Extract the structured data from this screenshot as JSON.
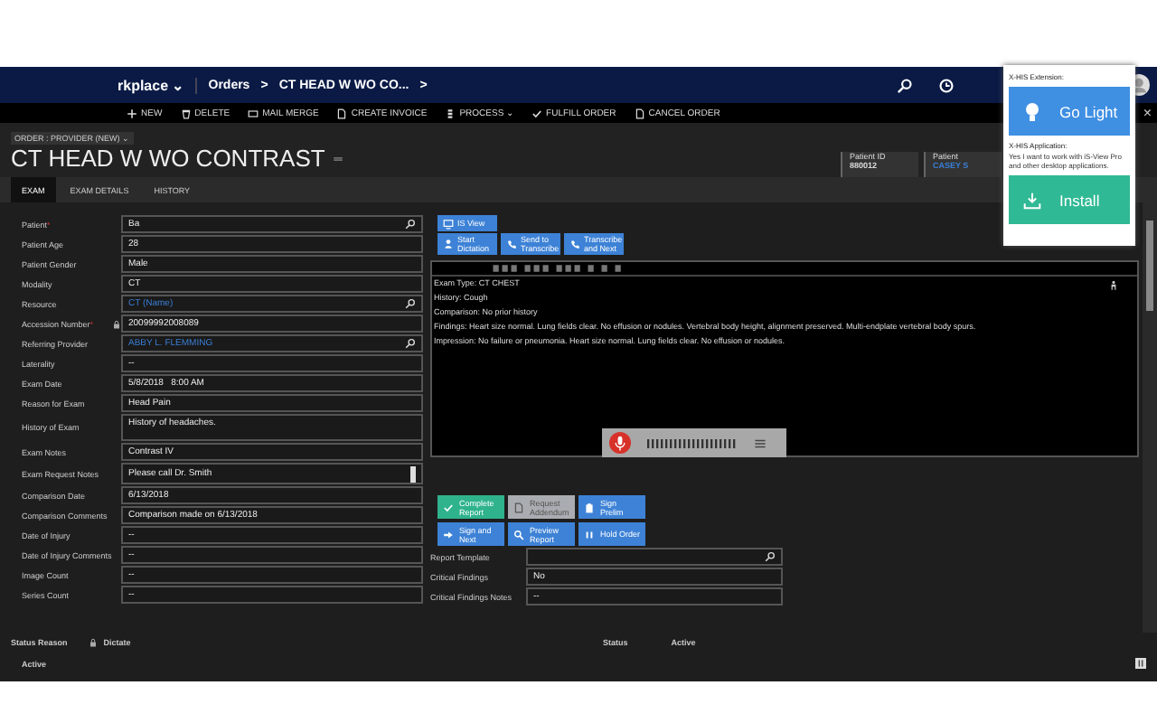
{
  "nav": {
    "app": "rkplace",
    "app_caret": "⌄",
    "crumbs": [
      {
        "label": "Orders",
        "chevron": ">"
      },
      {
        "label": "CT HEAD W WO CO...",
        "chevron": ">"
      }
    ]
  },
  "commands": [
    {
      "label": "NEW"
    },
    {
      "label": "DELETE"
    },
    {
      "label": "MAIL MERGE"
    },
    {
      "label": "CREATE INVOICE"
    },
    {
      "label": "PROCESS ⌄"
    },
    {
      "label": "FULFILL ORDER"
    },
    {
      "label": "CANCEL ORDER"
    }
  ],
  "close": "×",
  "header": {
    "form_selector": "ORDER : PROVIDER (NEW) ⌄",
    "title": "CT HEAD W WO CONTRAST",
    "tiles": [
      {
        "label": "Patient ID",
        "value": "880012",
        "link": false
      },
      {
        "label": "Patient",
        "value": "CASEY S",
        "link": true
      }
    ]
  },
  "tabs": [
    {
      "label": "EXAM",
      "selected": true
    },
    {
      "label": "EXAM DETAILS",
      "selected": false
    },
    {
      "label": "HISTORY",
      "selected": false
    }
  ],
  "fields": [
    {
      "label": "Patient",
      "value": "Ba",
      "kind": "lookup",
      "required_mark": "*",
      "locked": false,
      "link": false
    },
    {
      "label": "Patient Age",
      "value": "28",
      "kind": "text",
      "locked": false,
      "link": false
    },
    {
      "label": "Patient Gender",
      "value": "Male",
      "kind": "text",
      "locked": false,
      "link": false
    },
    {
      "label": "Modality",
      "value": "CT",
      "kind": "text",
      "locked": false,
      "link": false
    },
    {
      "label": "Resource",
      "value": "CT (Name)",
      "kind": "lookup",
      "locked": false,
      "link": true
    },
    {
      "label": "Accession Number",
      "value": "20099992008089",
      "kind": "text",
      "required_mark": "*",
      "locked": true,
      "link": false
    },
    {
      "label": "Referring Provider",
      "value": "ABBY L. FLEMMING",
      "kind": "lookup",
      "locked": false,
      "link": true
    },
    {
      "label": "Laterality",
      "value": "--",
      "kind": "text",
      "locked": false,
      "link": false
    },
    {
      "label": "Exam Date",
      "value": "5/8/2018   8:00 AM",
      "kind": "text",
      "locked": false,
      "link": false
    },
    {
      "label": "Reason for Exam",
      "value": "Head Pain",
      "kind": "text",
      "locked": false,
      "link": false
    },
    {
      "label": "History of Exam",
      "value": "History of headaches.",
      "kind": "multiline",
      "locked": false,
      "link": false
    },
    {
      "label": "Exam Notes",
      "value": "Contrast IV",
      "kind": "text",
      "locked": false,
      "link": false
    },
    {
      "label": "Exam Request Notes",
      "value": "Please call Dr. Smith",
      "kind": "scroll",
      "locked": false,
      "link": false
    },
    {
      "label": "Comparison Date",
      "value": "6/13/2018",
      "kind": "text",
      "locked": false,
      "link": false
    },
    {
      "label": "Comparison Comments",
      "value": "Comparison made on 6/13/2018",
      "kind": "text",
      "locked": false,
      "link": false
    },
    {
      "label": "Date of Injury",
      "value": "--",
      "kind": "text",
      "locked": false,
      "link": false
    },
    {
      "label": "Date of Injury Comments",
      "value": "--",
      "kind": "text",
      "locked": false,
      "link": false
    },
    {
      "label": "Image Count",
      "value": "--",
      "kind": "text",
      "locked": false,
      "link": false
    },
    {
      "label": "Series Count",
      "value": "--",
      "kind": "text",
      "locked": false,
      "link": false
    }
  ],
  "view_button": "IS View",
  "dictation_buttons": [
    {
      "label": "Start Dictation"
    },
    {
      "label": "Send to Transcribe"
    },
    {
      "label": "Transcribe and Next"
    }
  ],
  "report_lines": [
    "Exam Type: CT CHEST",
    "History: Cough",
    "Comparison: No prior history",
    "Findings: Heart size normal.  Lung fields clear.  No effusion or nodules.  Vertebral body height, alignment preserved.  Multi-endplate vertebral body spurs.",
    "Impression: No failure or pneumonia.  Heart size normal.  Lung fields clear.  No effusion or nodules."
  ],
  "action_buttons": [
    {
      "label": "Complete Report",
      "kind": "green",
      "disabled": false
    },
    {
      "label": "Request Addendum",
      "kind": "grey",
      "disabled": true
    },
    {
      "label": "Sign Prelim",
      "kind": "blue",
      "disabled": false
    },
    {
      "label": "Sign and Next",
      "kind": "blue",
      "disabled": false
    },
    {
      "label": "Preview Report",
      "kind": "blue",
      "disabled": false
    },
    {
      "label": "Hold Order",
      "kind": "blue",
      "disabled": false
    }
  ],
  "report_fields": [
    {
      "label": "Report Template",
      "kind": "lookup"
    },
    {
      "label": "Critical Findings",
      "value": "No",
      "kind": "text"
    },
    {
      "label": "Critical Findings Notes",
      "value": "--",
      "kind": "text"
    }
  ],
  "footer": {
    "status_reason_label": "Status Reason",
    "dictate": "Dictate",
    "status_label": "Status",
    "status_value": "Active",
    "right_status": "Active"
  },
  "popup": {
    "extension_label": "X-HIS Extension:",
    "go_light": "Go Light",
    "application_label": "X-HIS Application:",
    "application_text": "Yes I want to work with iS-View Pro and other desktop applications.",
    "install": "Install"
  }
}
